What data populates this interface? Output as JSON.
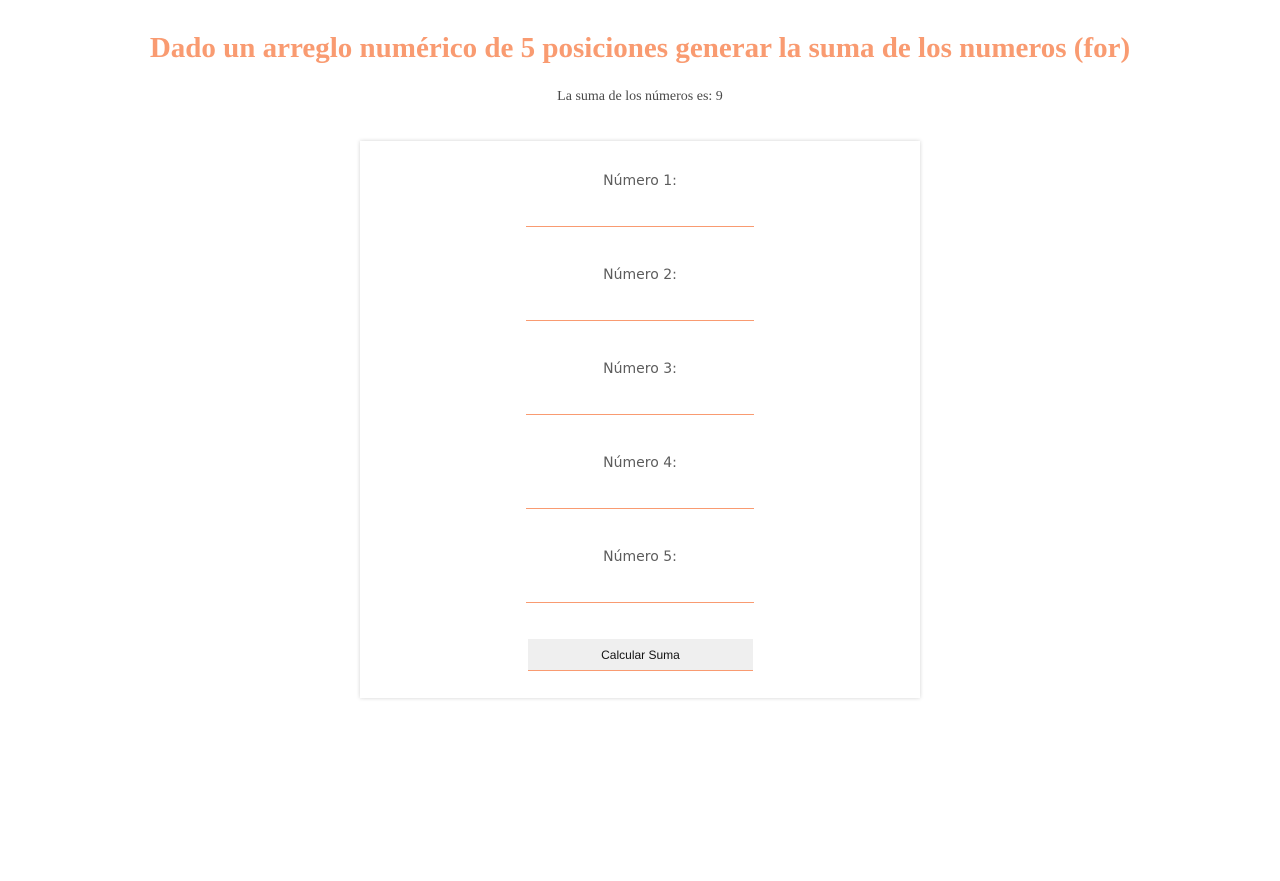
{
  "header": {
    "title": "Dado un arreglo numérico de 5 posiciones generar la suma de los numeros (for)"
  },
  "result": {
    "text": "La suma de los números es: 9"
  },
  "form": {
    "fields": [
      {
        "label": "Número 1:",
        "value": ""
      },
      {
        "label": "Número 2:",
        "value": ""
      },
      {
        "label": "Número 3:",
        "value": ""
      },
      {
        "label": "Número 4:",
        "value": ""
      },
      {
        "label": "Número 5:",
        "value": ""
      }
    ],
    "submit_label": "Calcular Suma"
  },
  "colors": {
    "accent": "#f99b71",
    "text": "#5c5c5c",
    "button_bg": "#efefef"
  }
}
